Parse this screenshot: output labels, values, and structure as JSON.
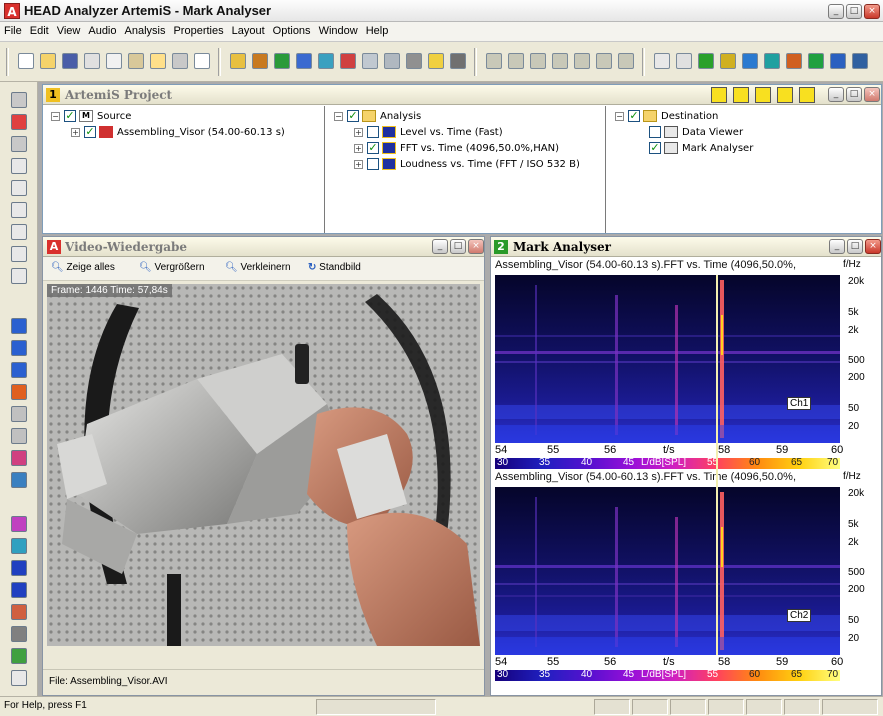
{
  "window": {
    "title": "HEAD Analyzer ArtemiS - Mark Analyser",
    "app_icon_letter": "A",
    "controls": [
      "_",
      "□",
      "×"
    ]
  },
  "menu": [
    "File",
    "Edit",
    "View",
    "Audio",
    "Analysis",
    "Properties",
    "Layout",
    "Options",
    "Window",
    "Help"
  ],
  "project": {
    "number": "1",
    "title": "ArtemiS Project",
    "source": {
      "root_label": "Source",
      "root_badge": "M",
      "item_label": "Assembling_Visor (54.00-60.13 s)"
    },
    "analysis": {
      "root_label": "Analysis",
      "items": [
        {
          "label": "Level vs. Time (Fast)",
          "checked": false
        },
        {
          "label": "FFT vs. Time (4096,50.0%,HAN)",
          "checked": true
        },
        {
          "label": "Loudness vs. Time (FFT / ISO 532 B)",
          "checked": false
        }
      ]
    },
    "destination": {
      "root_label": "Destination",
      "items": [
        {
          "label": "Data Viewer",
          "checked": false
        },
        {
          "label": "Mark Analyser",
          "checked": true
        }
      ]
    }
  },
  "video": {
    "title": "Video-Wiedergabe",
    "tools": {
      "show_all": "Zeige alles",
      "zoom_in": "Vergrößern",
      "zoom_out": "Verkleinern",
      "still": "Standbild"
    },
    "overlay": "Frame: 1446 Time: 57,84s",
    "file_label": "File: Assembling_Visor.AVI"
  },
  "mark": {
    "number": "2",
    "title": "Mark Analyser",
    "plots": [
      {
        "caption": "Assembling_Visor (54.00-60.13 s).FFT vs. Time (4096,50.0%,",
        "y_unit": "f/Hz",
        "channel": "Ch1"
      },
      {
        "caption": "Assembling_Visor (54.00-60.13 s).FFT vs. Time (4096,50.0%,",
        "y_unit": "f/Hz",
        "channel": "Ch2"
      }
    ],
    "y_ticks": [
      "20k",
      "5k",
      "2k",
      "500",
      "200",
      "50",
      "20"
    ],
    "x_ticks": [
      "54",
      "55",
      "56",
      "t/s",
      "58",
      "59",
      "60"
    ],
    "cbar_ticks": [
      "30",
      "35",
      "40",
      "45",
      "L/dB[SPL]",
      "55",
      "60",
      "65",
      "70"
    ],
    "cursor_time": 57.84
  },
  "status": {
    "text": "For Help, press F1"
  }
}
